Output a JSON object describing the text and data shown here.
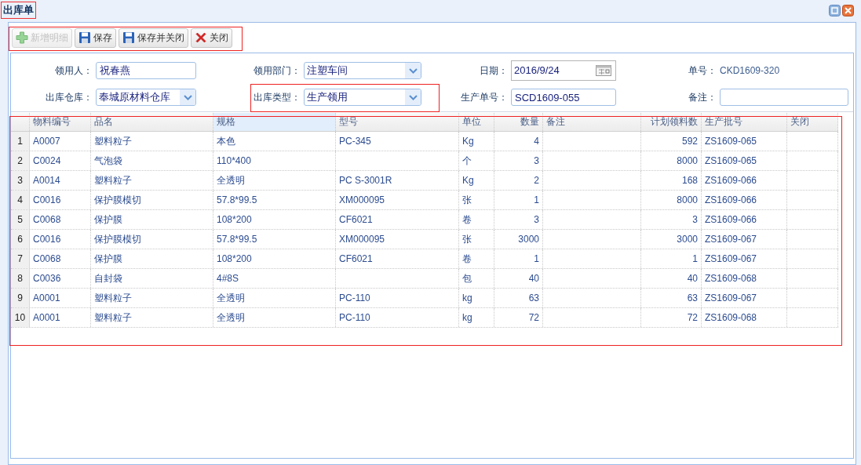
{
  "window": {
    "title": "出库单"
  },
  "toolbar": [
    {
      "label": "新增明细",
      "kind": "add",
      "disabled": true
    },
    {
      "label": "保存",
      "kind": "save",
      "disabled": false
    },
    {
      "label": "保存并关闭",
      "kind": "save",
      "disabled": false
    },
    {
      "label": "关闭",
      "kind": "close",
      "disabled": false
    }
  ],
  "form": [
    [
      {
        "label": "领用人：",
        "kind": "text",
        "value": "祝春燕"
      },
      {
        "label": "领用部门：",
        "kind": "select",
        "value": "注塑车间"
      },
      {
        "label": "日期：",
        "kind": "date",
        "value": "2016/9/24"
      },
      {
        "label": "单号：",
        "kind": "static",
        "value": "CKD1609-320"
      }
    ],
    [
      {
        "label": "出库仓库：",
        "kind": "select",
        "value": "奉城原材料仓库"
      },
      {
        "label": "出库类型：",
        "kind": "select",
        "value": "生产领用"
      },
      {
        "label": "生产单号：",
        "kind": "text",
        "value": "SCD1609-055"
      },
      {
        "label": "备注：",
        "kind": "text"
      }
    ]
  ],
  "table": {
    "columns": [
      {
        "label": "物料编号",
        "kind": "text",
        "selected": false
      },
      {
        "label": "品名",
        "kind": "text",
        "selected": false
      },
      {
        "label": "规格",
        "kind": "text",
        "selected": true
      },
      {
        "label": "型号",
        "kind": "text",
        "selected": false
      },
      {
        "label": "单位",
        "kind": "text",
        "selected": false
      },
      {
        "label": "数量",
        "kind": "number",
        "selected": false
      },
      {
        "label": "备注",
        "kind": "text",
        "selected": false
      },
      {
        "label": "计划领料数",
        "kind": "number",
        "selected": false
      },
      {
        "label": "生产批号",
        "kind": "text",
        "selected": false
      },
      {
        "label": "关闭",
        "kind": "text",
        "selected": false
      }
    ],
    "rows": [
      {
        "index": "1",
        "cells": [
          "A0007",
          "塑料粒子",
          "本色",
          "PC-345",
          "Kg",
          "4",
          "",
          "592",
          "ZS1609-065",
          ""
        ]
      },
      {
        "index": "2",
        "cells": [
          "C0024",
          "气泡袋",
          "110*400",
          "",
          "个",
          "3",
          "",
          "8000",
          "ZS1609-065",
          ""
        ]
      },
      {
        "index": "3",
        "cells": [
          "A0014",
          "塑料粒子",
          "全透明",
          "PC S-3001R",
          "Kg",
          "2",
          "",
          "168",
          "ZS1609-066",
          ""
        ]
      },
      {
        "index": "4",
        "cells": [
          "C0016",
          "保护膜模切",
          "57.8*99.5",
          "XM000095",
          "张",
          "1",
          "",
          "8000",
          "ZS1609-066",
          ""
        ]
      },
      {
        "index": "5",
        "cells": [
          "C0068",
          "保护膜",
          "108*200",
          "CF6021",
          "卷",
          "3",
          "",
          "3",
          "ZS1609-066",
          ""
        ]
      },
      {
        "index": "6",
        "cells": [
          "C0016",
          "保护膜模切",
          "57.8*99.5",
          "XM000095",
          "张",
          "3000",
          "",
          "3000",
          "ZS1609-067",
          ""
        ]
      },
      {
        "index": "7",
        "cells": [
          "C0068",
          "保护膜",
          "108*200",
          "CF6021",
          "卷",
          "1",
          "",
          "1",
          "ZS1609-067",
          ""
        ]
      },
      {
        "index": "8",
        "cells": [
          "C0036",
          "自封袋",
          "4#8S",
          "",
          "包",
          "40",
          "",
          "40",
          "ZS1609-068",
          ""
        ]
      },
      {
        "index": "9",
        "cells": [
          "A0001",
          "塑料粒子",
          "全透明",
          "PC-110",
          "kg",
          "63",
          "",
          "63",
          "ZS1609-067",
          ""
        ]
      },
      {
        "index": "10",
        "cells": [
          "A0001",
          "塑料粒子",
          "全透明",
          "PC-110",
          "kg",
          "72",
          "",
          "72",
          "ZS1609-068",
          ""
        ]
      }
    ]
  }
}
